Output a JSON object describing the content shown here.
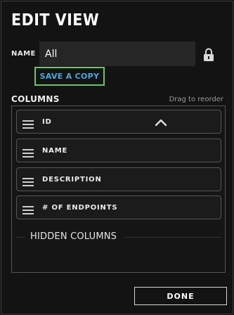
{
  "dialog": {
    "title": "EDIT VIEW",
    "name_label": "NAME",
    "name_value": "All",
    "lock_icon": "lock-icon",
    "save_copy_label": "SAVE A COPY",
    "done_label": "DONE"
  },
  "columns": {
    "label": "COLUMNS",
    "drag_hint": "Drag to reorder",
    "items": [
      {
        "label": "ID",
        "icon": "hamburger-icon",
        "expanded": true
      },
      {
        "label": "NAME",
        "icon": "hamburger-icon"
      },
      {
        "label": "DESCRIPTION",
        "icon": "hamburger-icon"
      },
      {
        "label": "# OF ENDPOINTS",
        "icon": "hamburger-icon"
      }
    ],
    "hidden_label": "HIDDEN COLUMNS"
  },
  "colors": {
    "background": "#121212",
    "save_copy_text": "#4aa8d8",
    "focus_outline": "#6cc36a"
  }
}
